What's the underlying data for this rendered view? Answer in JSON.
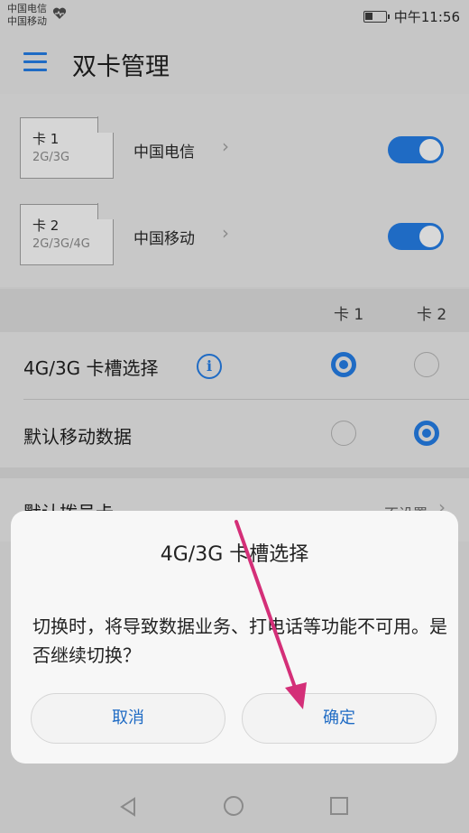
{
  "status_bar": {
    "carrier_1": "中国电信",
    "carrier_2": "中国移动",
    "time": "中午11:56",
    "icons": [
      "heart-rate-icon",
      "battery-icon"
    ]
  },
  "toolbar": {
    "menu_icon": "menu-icon",
    "title": "双卡管理"
  },
  "sim_cards": [
    {
      "card": "卡 1",
      "tech": "2G/3G",
      "carrier": "中国电信",
      "enabled": true
    },
    {
      "card": "卡 2",
      "tech": "2G/3G/4G",
      "carrier": "中国移动",
      "enabled": true
    }
  ],
  "slot_settings": {
    "col_1": "卡 1",
    "col_2": "卡 2",
    "rows": [
      {
        "label": "4G/3G 卡槽选择",
        "selected": "卡 1",
        "icon": "info-icon"
      },
      {
        "label": "默认移动数据",
        "selected": "卡 2"
      }
    ]
  },
  "dial": {
    "label": "默认拨号卡",
    "value": "不设置"
  },
  "dialog": {
    "title": "4G/3G 卡槽选择",
    "message": "切换时，将导致数据业务、打电话等功能不可用。是否继续切换？",
    "cancel_label": "取消",
    "confirm_label": "确定"
  },
  "colors": {
    "accent": "#1f6bc4",
    "annotation_arrow": "#d42f78"
  },
  "nav_bar": {
    "icons": [
      "back-icon",
      "home-icon",
      "recent-apps-icon"
    ]
  }
}
